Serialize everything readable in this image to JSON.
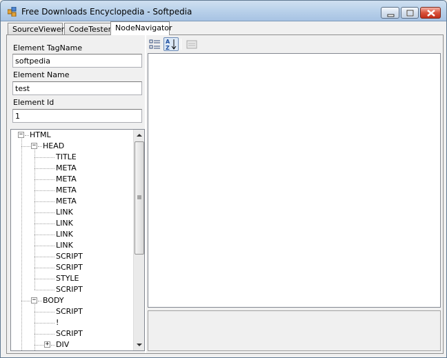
{
  "window": {
    "title": "Free Downloads Encyclopedia - Softpedia"
  },
  "tabs": [
    {
      "label": "SourceViewer",
      "active": false
    },
    {
      "label": "CodeTester",
      "active": false
    },
    {
      "label": "NodeNavigator",
      "active": true
    }
  ],
  "fields": {
    "tagname": {
      "label": "Element TagName",
      "value": "softpedia"
    },
    "name": {
      "label": "Element Name",
      "value": "test"
    },
    "id": {
      "label": "Element Id",
      "value": "1"
    }
  },
  "tree": {
    "nodes": [
      {
        "label": "HTML",
        "level": 0,
        "expander": "−"
      },
      {
        "label": "HEAD",
        "level": 1,
        "expander": "−"
      },
      {
        "label": "TITLE",
        "level": 2,
        "expander": ""
      },
      {
        "label": "META",
        "level": 2,
        "expander": ""
      },
      {
        "label": "META",
        "level": 2,
        "expander": ""
      },
      {
        "label": "META",
        "level": 2,
        "expander": ""
      },
      {
        "label": "META",
        "level": 2,
        "expander": ""
      },
      {
        "label": "LINK",
        "level": 2,
        "expander": ""
      },
      {
        "label": "LINK",
        "level": 2,
        "expander": ""
      },
      {
        "label": "LINK",
        "level": 2,
        "expander": ""
      },
      {
        "label": "LINK",
        "level": 2,
        "expander": ""
      },
      {
        "label": "SCRIPT",
        "level": 2,
        "expander": ""
      },
      {
        "label": "SCRIPT",
        "level": 2,
        "expander": ""
      },
      {
        "label": "STYLE",
        "level": 2,
        "expander": ""
      },
      {
        "label": "SCRIPT",
        "level": 2,
        "expander": ""
      },
      {
        "label": "BODY",
        "level": 1,
        "expander": "−"
      },
      {
        "label": "SCRIPT",
        "level": 2,
        "expander": ""
      },
      {
        "label": "!",
        "level": 2,
        "expander": ""
      },
      {
        "label": "SCRIPT",
        "level": 2,
        "expander": ""
      },
      {
        "label": "DIV",
        "level": 2,
        "expander": "+"
      }
    ]
  },
  "toolbar": {
    "categorized_icon": "categorized-icon",
    "alphabetical_icon": "alphabetical-icon",
    "property_pages_icon": "property-pages-icon"
  }
}
